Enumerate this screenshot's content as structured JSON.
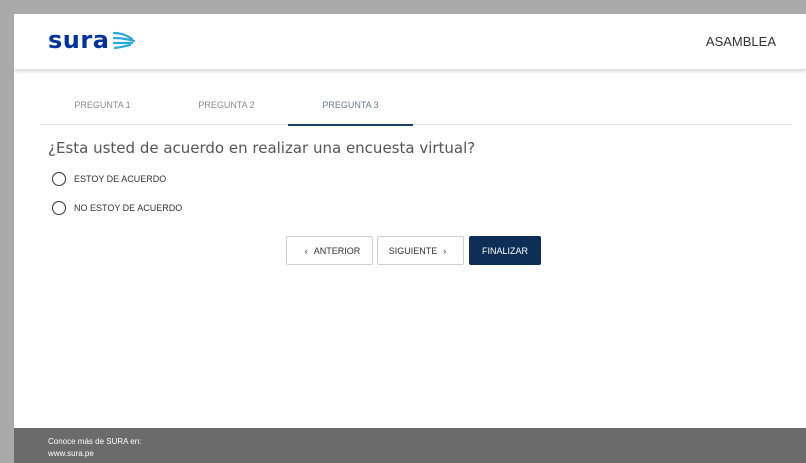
{
  "header": {
    "logo_text": "sura",
    "title": "ASAMBLEA"
  },
  "tabs": [
    {
      "label": "PREGUNTA 1",
      "active": false
    },
    {
      "label": "PREGUNTA 2",
      "active": false
    },
    {
      "label": "PREGUNTA 3",
      "active": true
    }
  ],
  "question": {
    "text": "¿Esta usted de acuerdo en realizar una encuesta virtual?",
    "options": [
      {
        "label": "ESTOY DE ACUERDO",
        "selected": false
      },
      {
        "label": "NO ESTOY DE ACUERDO",
        "selected": false
      }
    ]
  },
  "buttons": {
    "previous": "ANTERIOR",
    "next": "SIGUIENTE",
    "finish": "FINALIZAR"
  },
  "footer": {
    "line1": "Conoce más de SURA en:",
    "line2": "www.sura.pe"
  },
  "colors": {
    "brand_blue": "#0033a0",
    "logo_accent": "#2aa8d8",
    "primary_button": "#0d2e56",
    "footer_bg": "#6b6b6b"
  }
}
